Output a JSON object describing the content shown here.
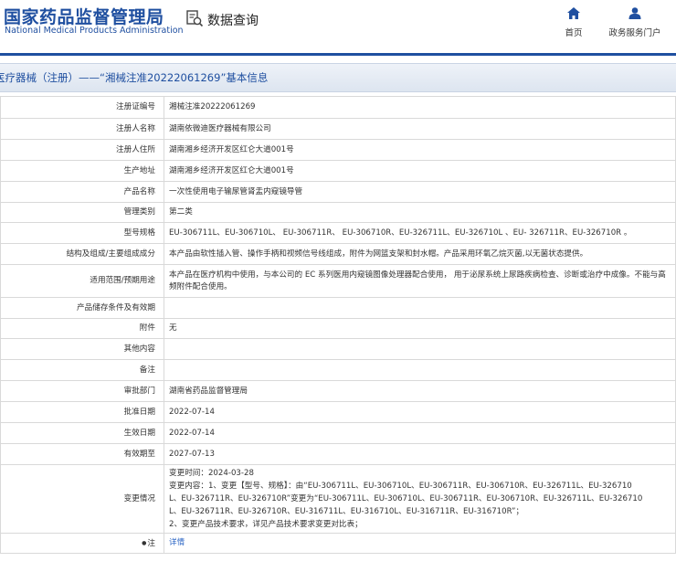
{
  "header": {
    "logo_cn": "国家药品监督管理局",
    "logo_en": "National Medical Products Administration",
    "query_label": "数据查询",
    "nav": [
      {
        "label": "首页",
        "icon": "home-icon"
      },
      {
        "label": "政务服务门户",
        "icon": "user-icon"
      }
    ]
  },
  "colors": {
    "brand": "#1f4fa0",
    "link": "#2a64c4",
    "border": "#d9d9d9"
  },
  "title": "医疗器械（注册）——“湘械注准20222061269”基本信息",
  "rows": [
    {
      "key": "注册证编号",
      "value": "湘械注准20222061269"
    },
    {
      "key": "注册人名称",
      "value": "湖南依微迪医疗器械有限公司"
    },
    {
      "key": "注册人住所",
      "value": "湖南湘乡经济开发区红仑大道001号"
    },
    {
      "key": "生产地址",
      "value": "湖南湘乡经济开发区红仑大道001号"
    },
    {
      "key": "产品名称",
      "value": "一次性使用电子输尿管肾盂内窥镜导管"
    },
    {
      "key": "管理类别",
      "value": "第二类"
    },
    {
      "key": "型号规格",
      "value": "EU-306711L、EU-306710L、 EU-306711R、 EU-306710R、EU-326711L、EU-326710L 、EU- 326711R、EU-326710R 。"
    },
    {
      "key": "结构及组成/主要组成成分",
      "value": "本产品由软性插入管、操作手柄和视频信号线组成，附件为网篮支架和封水帽。产品采用环氧乙烷灭菌,以无菌状态提供。"
    },
    {
      "key": "适用范围/预期用途",
      "value": "本产品在医疗机构中使用，与本公司的 EC 系列医用内窥镜图像处理器配合使用， 用于泌尿系统上尿路疾病检查、诊断或治疗中成像。不能与高频附件配合使用。"
    },
    {
      "key": "产品储存条件及有效期",
      "value": ""
    },
    {
      "key": "附件",
      "value": "无"
    },
    {
      "key": "其他内容",
      "value": ""
    },
    {
      "key": "备注",
      "value": ""
    },
    {
      "key": "审批部门",
      "value": "湖南省药品监督管理局"
    },
    {
      "key": "批准日期",
      "value": "2022-07-14"
    },
    {
      "key": "生效日期",
      "value": "2022-07-14"
    },
    {
      "key": "有效期至",
      "value": "2027-07-13"
    },
    {
      "key": "变更情况",
      "lines": [
        "变更时间：2024-03-28",
        "变更内容：1、变更【型号、规格】：由“EU-306711L、EU-306710L、EU-306711R、EU-306710R、EU-326711L、EU-326710",
        "L、EU-326711R、EU-326710R”变更为“EU-306711L、EU-306710L、EU-306711R、EU-306710R、EU-326711L、EU-326710",
        "L、EU-326711R、EU-326710R、EU-316711L、EU-316710L、EU-316711R、EU-316710R”；",
        "2、变更产品技术要求，详见产品技术要求变更对比表；"
      ]
    },
    {
      "key": "注",
      "value": "详情",
      "link": true
    }
  ]
}
